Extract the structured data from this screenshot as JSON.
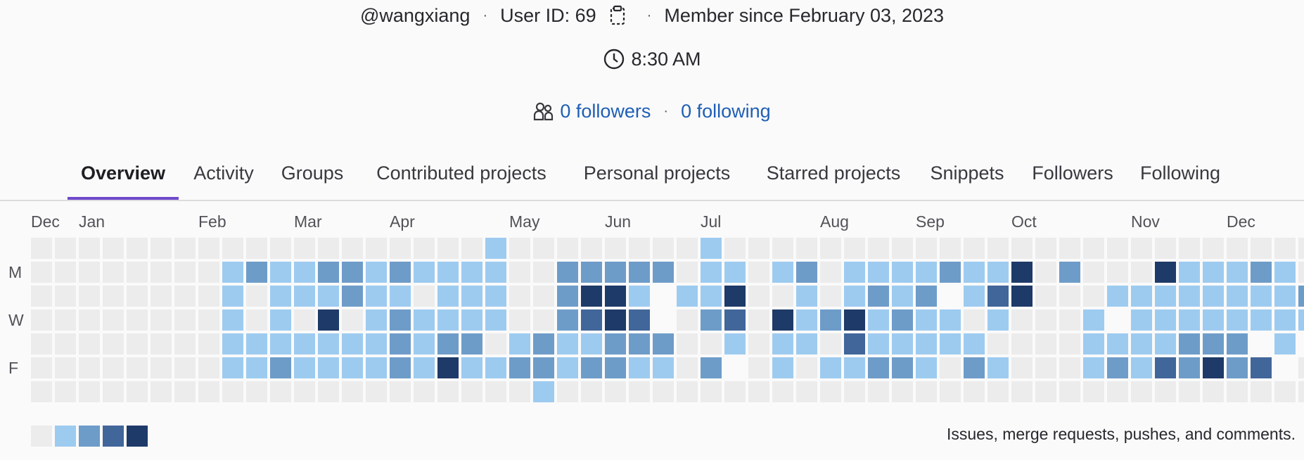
{
  "profile": {
    "username": "@wangxiang",
    "user_id_label": "User ID: 69",
    "member_since": "Member since February 03, 2023",
    "local_time": "8:30 AM",
    "followers_label": "0 followers",
    "following_label": "0 following"
  },
  "tabs": [
    {
      "label": "Overview",
      "active": true
    },
    {
      "label": "Activity"
    },
    {
      "label": "Groups"
    },
    {
      "label": "Contributed projects"
    },
    {
      "label": "Personal projects"
    },
    {
      "label": "Starred projects"
    },
    {
      "label": "Snippets"
    },
    {
      "label": "Followers"
    },
    {
      "label": "Following"
    }
  ],
  "calendar": {
    "months": [
      "Dec",
      "Jan",
      "Feb",
      "Mar",
      "Apr",
      "May",
      "Jun",
      "Jul",
      "Aug",
      "Sep",
      "Oct",
      "Nov",
      "Dec"
    ],
    "month_start_week": [
      0,
      2,
      7,
      11,
      15,
      20,
      24,
      28,
      33,
      37,
      41,
      46,
      50
    ],
    "day_labels": [
      {
        "row": 1,
        "label": "M"
      },
      {
        "row": 3,
        "label": "W"
      },
      {
        "row": 5,
        "label": "F"
      }
    ],
    "level_colors": [
      "#ececec",
      "#9dcbf0",
      "#6e9cc9",
      "#41669a",
      "#1e3a68"
    ],
    "weeks": [
      "0000000",
      "0000000",
      "0000000",
      "0000000",
      "0000000",
      "0000000",
      "0000000",
      "0000000",
      "0111110",
      "0200110",
      "0111120",
      "0110110",
      "0214110",
      "0220110",
      "0111110",
      "0212220",
      "0101110",
      "0111240",
      "0111210",
      "1111010",
      "0000120",
      "0000221",
      "0222110",
      "0243120",
      "0244220",
      "0213210",
      "0255210",
      "0010000",
      "1112020",
      "0143150",
      "0000000",
      "0104110",
      "0211100",
      "0002010",
      "0114310",
      "0121120",
      "0112120",
      "0121110",
      "0251100",
      "0110120",
      "0131010",
      "0440000",
      "0000000",
      "0200000",
      "0001110",
      "0015120",
      "0011110",
      "0411130",
      "0111220",
      "0111240",
      "0111220",
      "0211530",
      "0111150",
      "0021500",
      "0000000"
    ],
    "legend_text": "Issues, merge requests, pushes, and comments."
  }
}
